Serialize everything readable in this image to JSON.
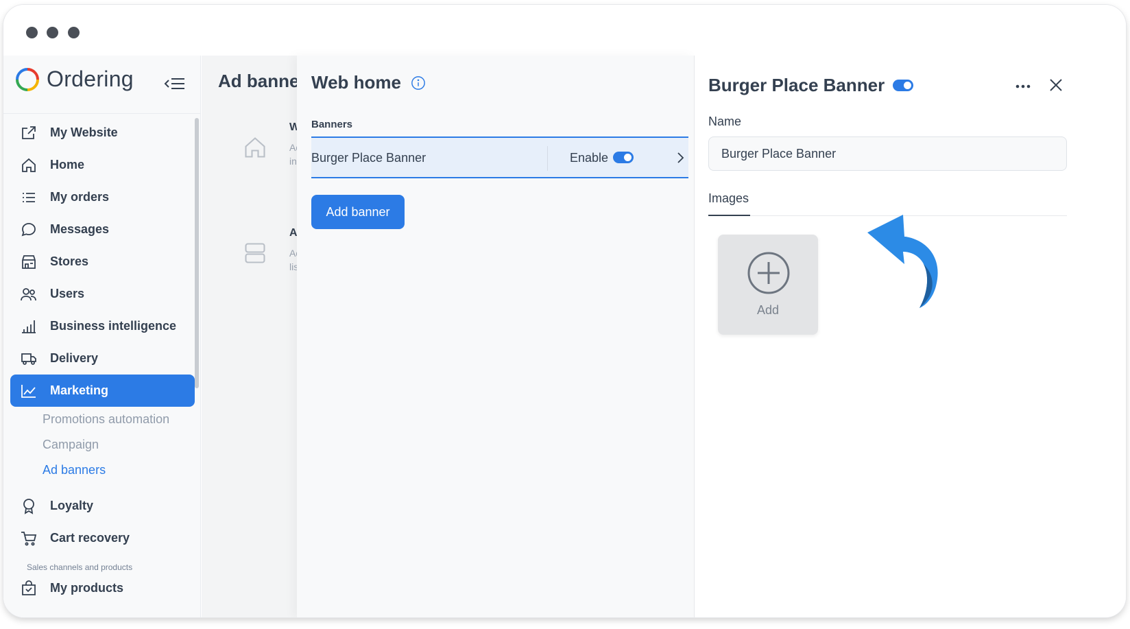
{
  "app": {
    "logo_text": "Ordering"
  },
  "sidebar": {
    "items": [
      {
        "label": "My Website",
        "icon": "external-link-icon"
      },
      {
        "label": "Home",
        "icon": "home-icon"
      },
      {
        "label": "My orders",
        "icon": "list-icon"
      },
      {
        "label": "Messages",
        "icon": "chat-icon"
      },
      {
        "label": "Stores",
        "icon": "shop-icon"
      },
      {
        "label": "Users",
        "icon": "users-icon"
      },
      {
        "label": "Business intelligence",
        "icon": "bar-chart-icon"
      },
      {
        "label": "Delivery",
        "icon": "truck-icon"
      },
      {
        "label": "Marketing",
        "icon": "line-chart-icon"
      },
      {
        "label": "Loyalty",
        "icon": "award-icon"
      },
      {
        "label": "Cart recovery",
        "icon": "cart-icon"
      },
      {
        "label": "My products",
        "icon": "bag-icon"
      }
    ],
    "marketing_sub": [
      {
        "label": "Promotions automation"
      },
      {
        "label": "Campaign"
      },
      {
        "label": "Ad banners"
      }
    ],
    "section_label": "Sales channels and products"
  },
  "background_page": {
    "title": "Ad banner",
    "cards": [
      {
        "title": "We",
        "line1": "Ad",
        "line2": "info"
      },
      {
        "title": "Ap",
        "line1": "Ad",
        "line2": "list"
      }
    ]
  },
  "middle": {
    "title": "Web home",
    "banners_label": "Banners",
    "banner": {
      "name": "Burger Place Banner",
      "enable_label": "Enable",
      "enabled": true
    },
    "add_banner_label": "Add banner"
  },
  "right": {
    "title": "Burger Place Banner",
    "enabled": true,
    "name_label": "Name",
    "name_value": "Burger Place Banner",
    "tab_images": "Images",
    "add_tile_label": "Add"
  },
  "colors": {
    "accent": "#2c7be5",
    "text": "#344050",
    "arrow": "#2c8be6"
  }
}
